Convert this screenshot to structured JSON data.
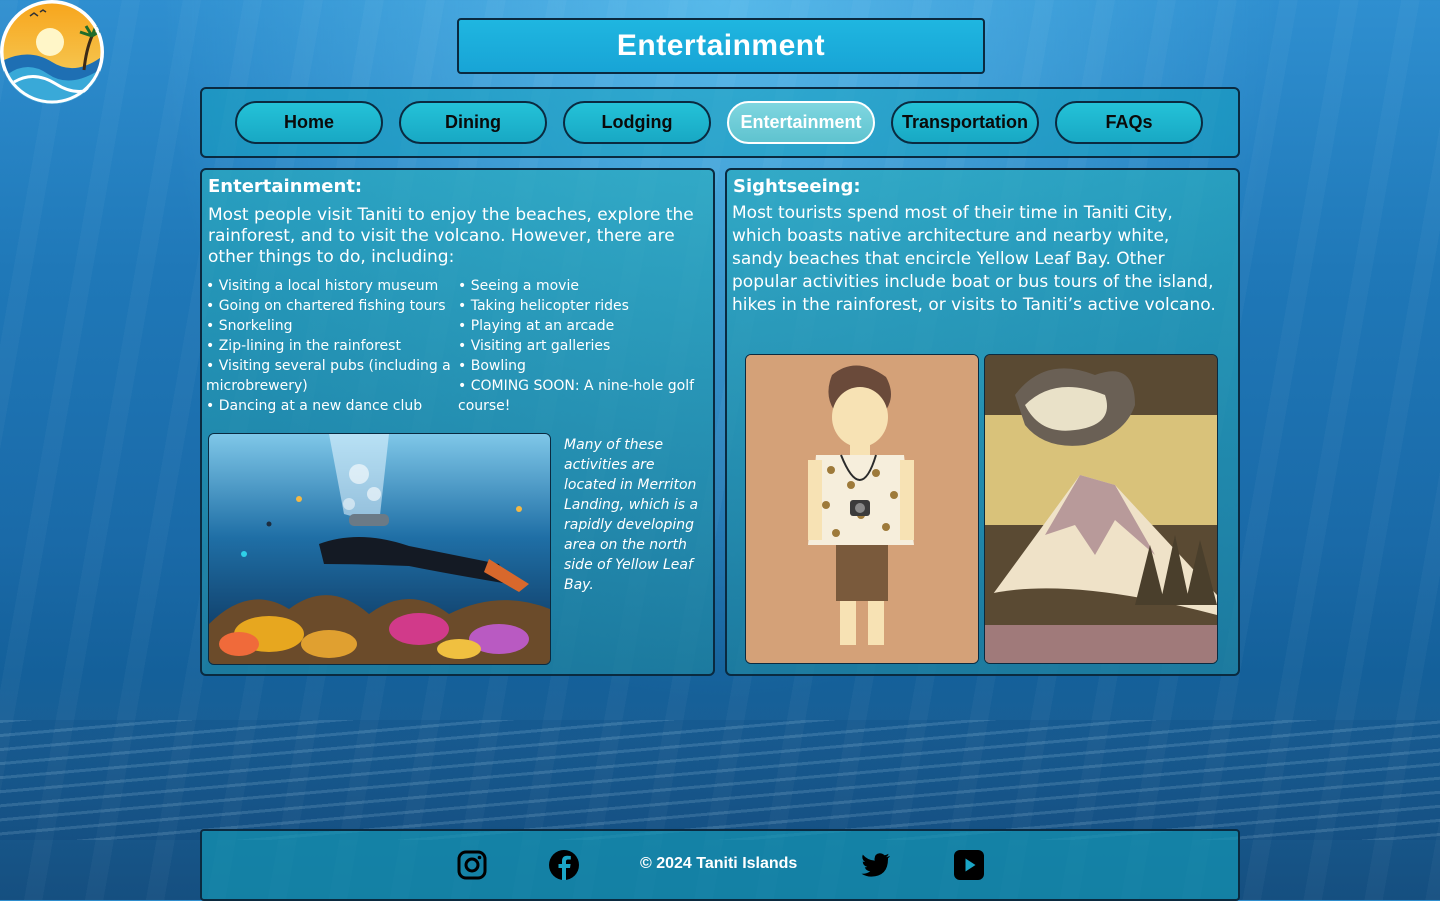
{
  "site": {
    "page_title": "Entertainment"
  },
  "nav": {
    "items": [
      {
        "label": "Home"
      },
      {
        "label": "Dining"
      },
      {
        "label": "Lodging"
      },
      {
        "label": "Entertainment",
        "active": true
      },
      {
        "label": "Transportation"
      },
      {
        "label": "FAQs"
      }
    ]
  },
  "entertainment": {
    "heading": "Entertainment:",
    "intro": "Most people visit Taniti to enjoy the beaches, explore the rainforest, and to visit the volcano. However, there are other things to do, including:",
    "list_left": [
      "• Visiting a local history museum",
      "• Going on chartered fishing tours",
      "• Snorkeling",
      "• Zip-lining in the rainforest",
      "• Visiting several pubs (including a microbrewery)",
      "• Dancing at a new dance club"
    ],
    "list_right": [
      "• Seeing a movie",
      "• Taking helicopter rides",
      "• Playing at an arcade",
      "• Visiting art galleries",
      "• Bowling",
      "• COMING SOON: A nine-hole golf course!"
    ],
    "caption": "Many of these activities are located in Merriton Landing, which is a rapidly developing area on the north side of Yellow Leaf Bay.​"
  },
  "sightseeing": {
    "heading": "Sightseeing:",
    "body": "Most tourists spend most of their time in Taniti City, which boasts native architecture and nearby white, sandy beaches that encircle Yellow Leaf Bay. Other popular activities include boat or bus tours of the island, hikes in the rainforest, or visits to Taniti’s active volcano."
  },
  "footer": {
    "copyright": "© 2024 Taniti Islands",
    "social": [
      "instagram-icon",
      "facebook-icon",
      "twitter-icon",
      "youtube-icon"
    ]
  },
  "colors": {
    "accent": "#1fb6e0",
    "nav_button": "#18a8c4",
    "active_nav": "#5fc3cf",
    "border": "#0a2a40"
  }
}
